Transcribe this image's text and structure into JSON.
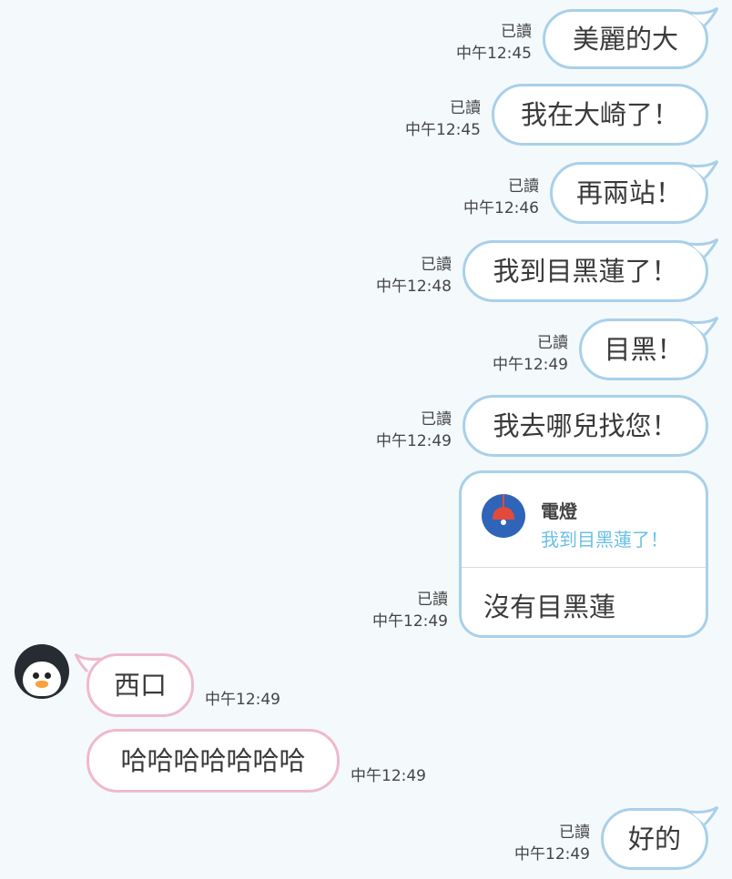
{
  "chat": {
    "read_label": "已讀",
    "messages": [
      {
        "text": "美麗的大",
        "read": "已讀",
        "time": "中午12:45"
      },
      {
        "text": "我在大崎了！",
        "read": "已讀",
        "time": "中午12:45"
      },
      {
        "text": "再兩站！",
        "read": "已讀",
        "time": "中午12:46"
      },
      {
        "text": "我到目黑蓮了！",
        "read": "已讀",
        "time": "中午12:48"
      },
      {
        "text": "目黑！",
        "read": "已讀",
        "time": "中午12:49"
      },
      {
        "text": "我去哪兒找您！",
        "read": "已讀",
        "time": "中午12:49"
      },
      {
        "text": "沒有目黑蓮",
        "read": "已讀",
        "time": "中午12:49",
        "reply_to": {
          "name": "電燈",
          "text": "我到目黑蓮了！",
          "icon": "lamp-icon"
        }
      },
      {
        "text": "西口",
        "time": "中午12:49",
        "incoming": true,
        "avatar": "penguin-avatar"
      },
      {
        "text": "哈哈哈哈哈哈哈",
        "time": "中午12:49",
        "incoming": true
      },
      {
        "text": "好的",
        "read": "已讀",
        "time": "中午12:49"
      }
    ]
  },
  "colors": {
    "background": "#f4f9fb",
    "outgoing_border": "#a9d0ea",
    "incoming_border": "#efb9cd",
    "quote_text": "#6cc0e3",
    "lamp_icon_bg": "#2f64b8",
    "lamp_red": "#e24a3b"
  }
}
